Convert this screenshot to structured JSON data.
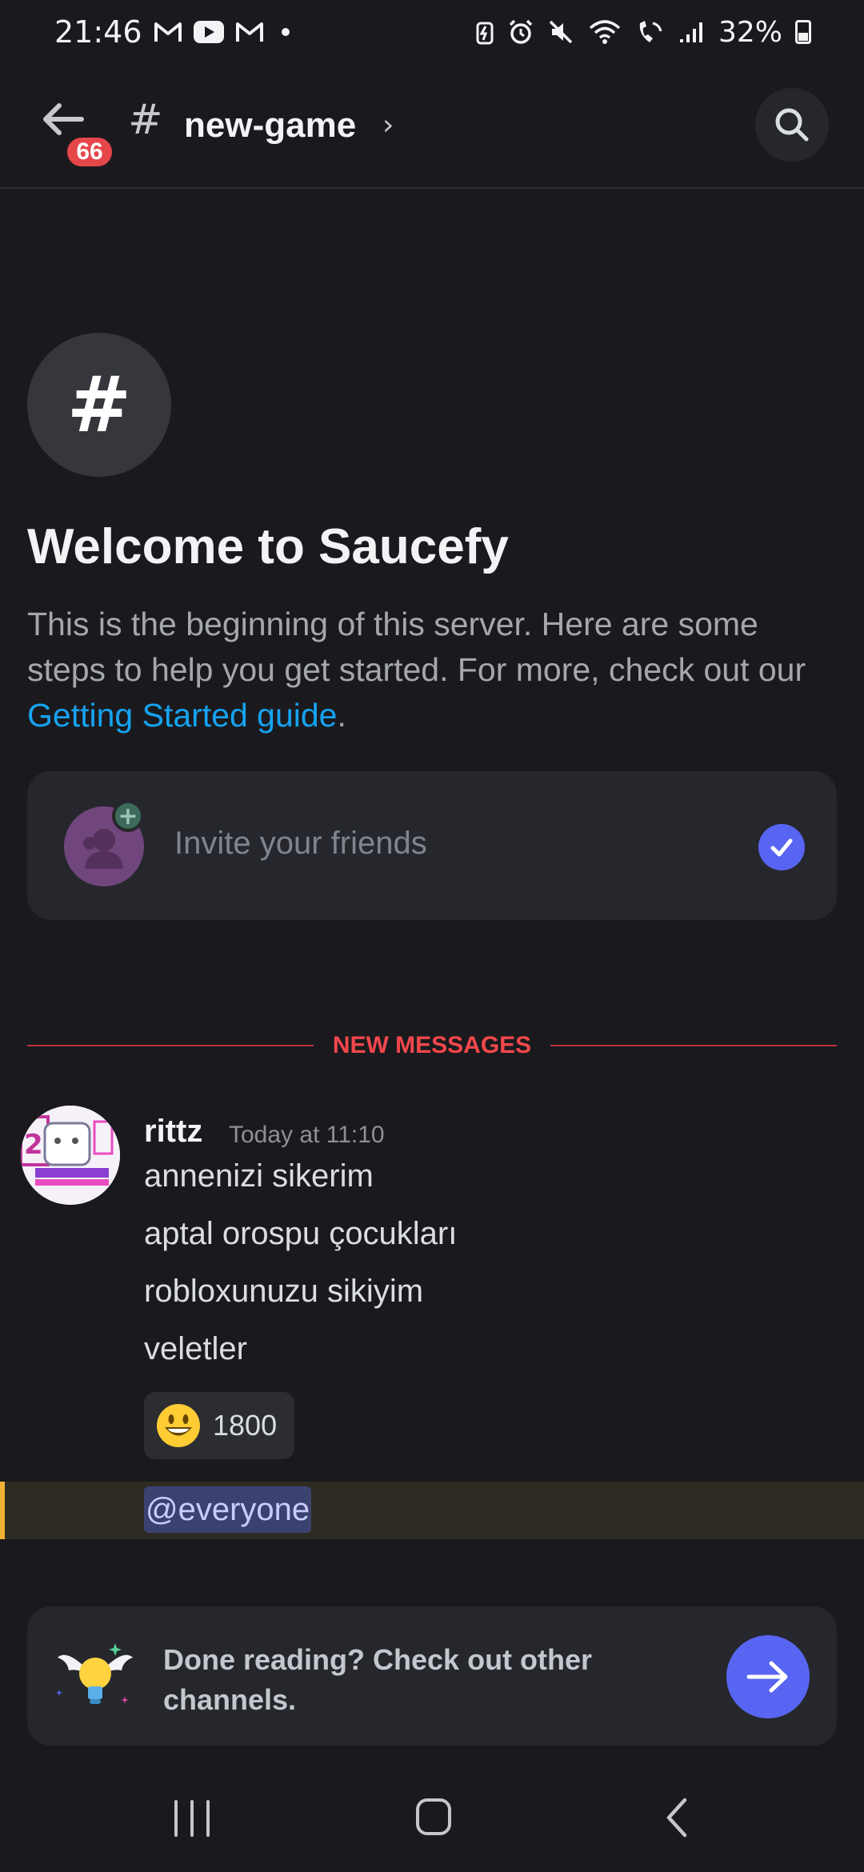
{
  "status_bar": {
    "time": "21:46",
    "battery": "32%"
  },
  "header": {
    "unread_badge": "66",
    "channel_hash": "#",
    "channel_name": "new-game",
    "chevron": "›"
  },
  "welcome": {
    "server_icon_glyph": "#",
    "title": "Welcome to Saucefy",
    "desc_before": "This is the beginning of this server. Here are some steps to help you get started. For more, check out our ",
    "desc_link": "Getting Started guide",
    "desc_after": "."
  },
  "invite_card": {
    "label": "Invite your friends",
    "completed": true
  },
  "divider": {
    "label": "NEW MESSAGES"
  },
  "message": {
    "username": "rittz",
    "timestamp": "Today at 11:10",
    "lines": [
      "annenizi sikerim",
      "aptal orospu çocukları",
      "robloxunuzu sikiyim",
      "veletler"
    ],
    "reaction": {
      "emoji": "😃",
      "count": "1800"
    },
    "mention": "@everyone"
  },
  "done_card": {
    "text": "Done reading? Check out other channels."
  },
  "colors": {
    "background": "#1a1a1e",
    "blurple": "#5865f2",
    "link": "#16a3f0",
    "new_messages_red": "#f2474c",
    "mention_highlight": "#f0b232"
  }
}
